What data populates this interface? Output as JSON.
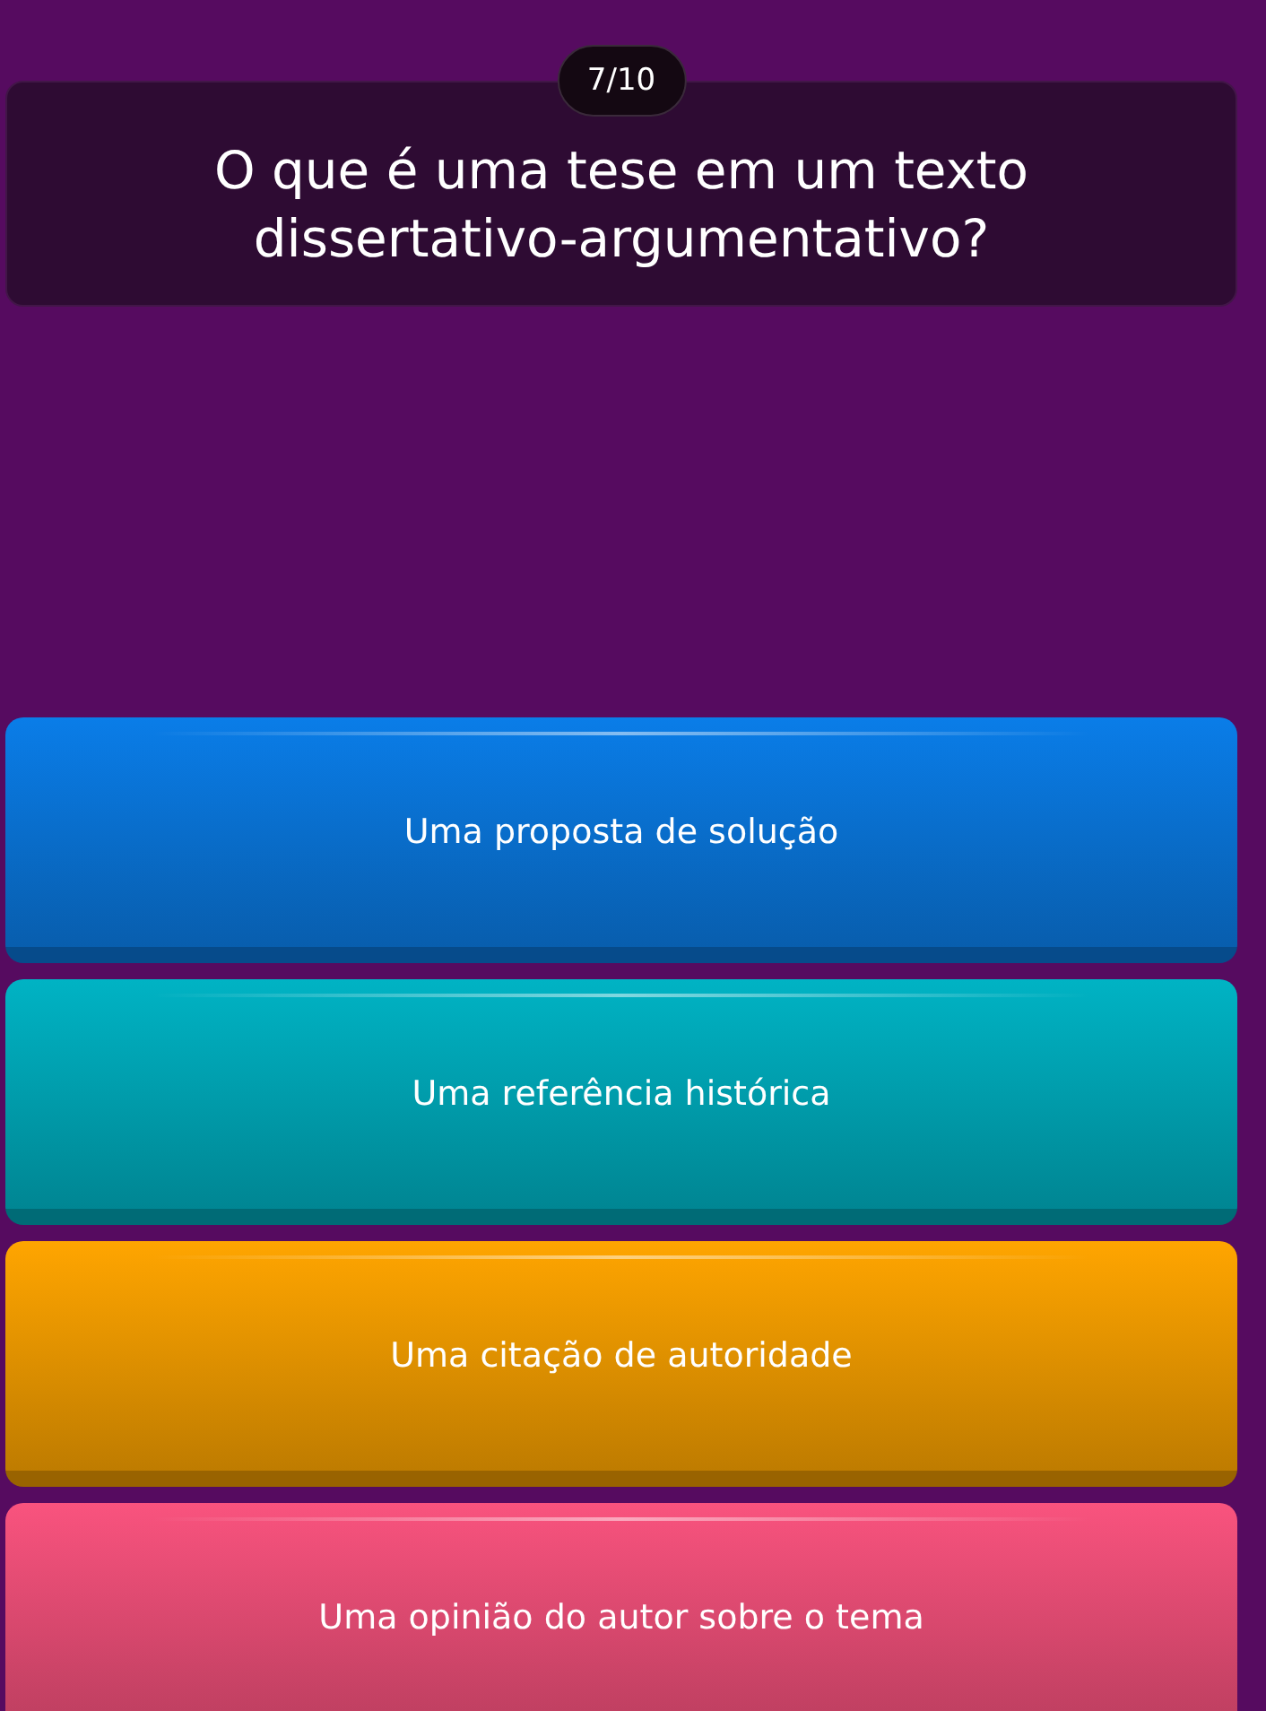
{
  "counter": "7/10",
  "question": "O que é uma tese em um texto dissertativo-argumentativo?",
  "answers": [
    {
      "text": "Uma proposta de solução",
      "color": "#0a7de8"
    },
    {
      "text": "Uma referência histórica",
      "color": "#00b3c4"
    },
    {
      "text": "Uma citação de autoridade",
      "color": "#ffa500"
    },
    {
      "text": "Uma opinião do autor sobre o tema",
      "color": "#f9537e"
    }
  ]
}
